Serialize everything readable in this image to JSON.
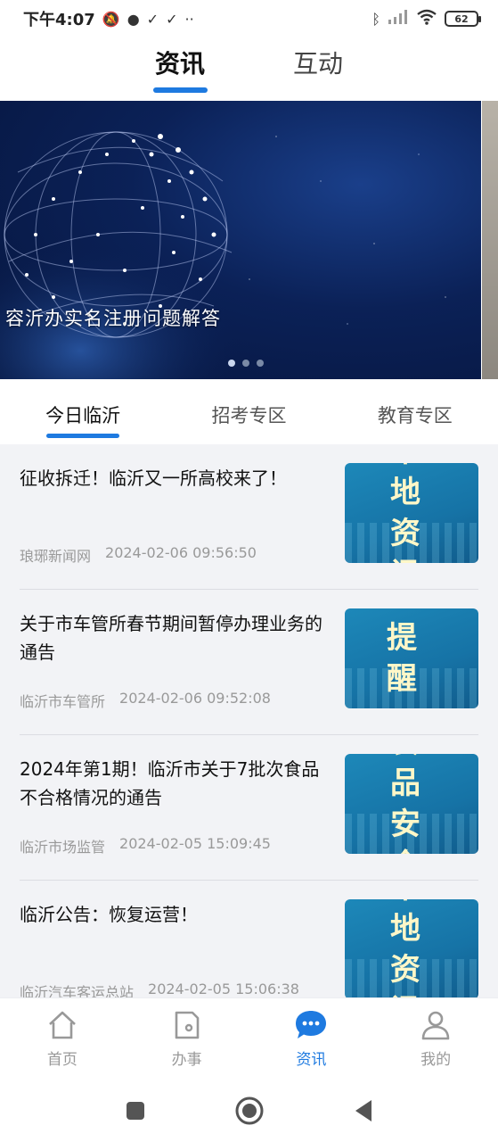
{
  "status_bar": {
    "time": "下午4:07",
    "battery": "62"
  },
  "top_tabs": [
    {
      "label": "资讯",
      "active": true
    },
    {
      "label": "互动",
      "active": false
    }
  ],
  "banner": {
    "caption": "容沂办实名注册问题解答",
    "slide_count": 3,
    "active_slide": 1
  },
  "category_tabs": [
    {
      "label": "今日临沂",
      "active": true
    },
    {
      "label": "招考专区",
      "active": false
    },
    {
      "label": "教育专区",
      "active": false
    }
  ],
  "news": [
    {
      "title": "征收拆迁！临沂又一所高校来了！",
      "source": "琅琊新闻网",
      "time": "2024-02-06 09:56:50",
      "thumb": "本 地\n资 讯"
    },
    {
      "title": "关于市车管所春节期间暂停办理业务的通告",
      "source": "临沂市车管所",
      "time": "2024-02-06 09:52:08",
      "thumb": "提 醒"
    },
    {
      "title": "2024年第1期！临沂市关于7批次食品不合格情况的通告",
      "source": "临沂市场监管",
      "time": "2024-02-05 15:09:45",
      "thumb": "食 品\n安 全"
    },
    {
      "title": "临沂公告：恢复运营！",
      "source": "临沂汽车客运总站",
      "time": "2024-02-05 15:06:38",
      "thumb": "本 地\n资 讯"
    }
  ],
  "bottom_nav": [
    {
      "label": "首页",
      "icon": "home-icon",
      "active": false
    },
    {
      "label": "办事",
      "icon": "document-icon",
      "active": false
    },
    {
      "label": "资讯",
      "icon": "chat-icon",
      "active": true
    },
    {
      "label": "我的",
      "icon": "user-icon",
      "active": false
    }
  ],
  "colors": {
    "accent": "#1e7ae0",
    "thumb_bg": "#1673a6",
    "list_bg": "#f2f3f6"
  }
}
